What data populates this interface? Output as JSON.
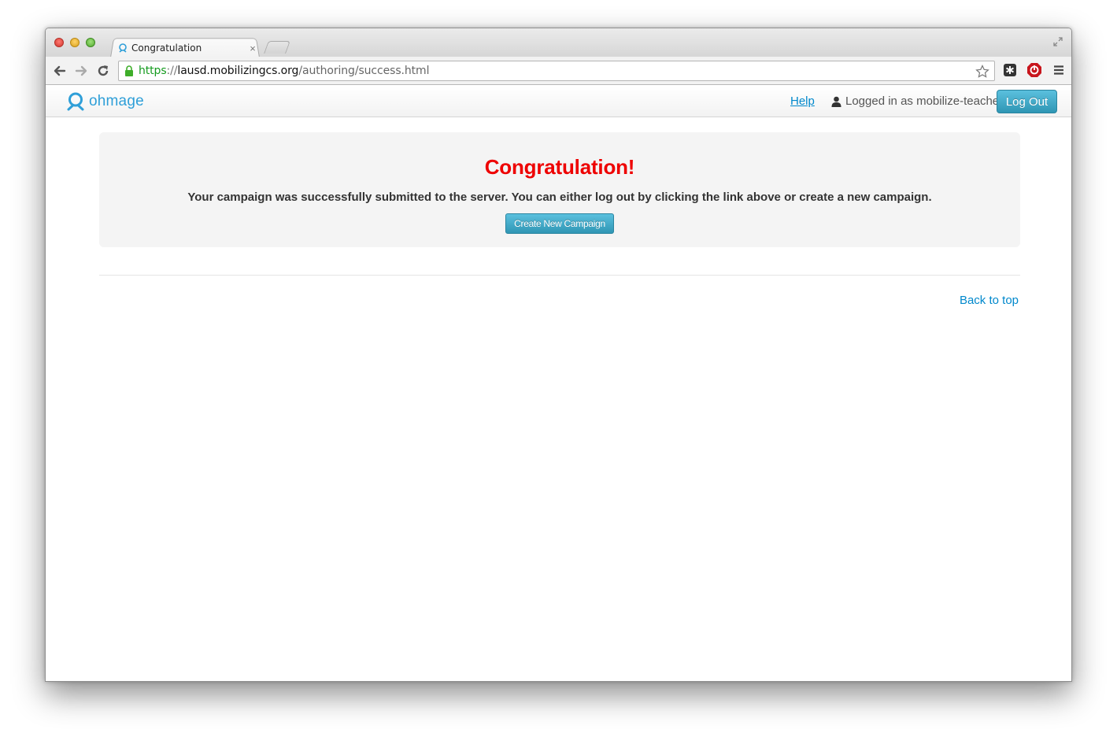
{
  "browser": {
    "tab_title": "Congratulation",
    "tab_close": "×",
    "url": {
      "scheme": "https",
      "separator": "://",
      "host": "lausd.mobilizingcs.org",
      "path": "/authoring/success.html"
    },
    "icons": [
      "back-icon",
      "forward-icon",
      "reload-icon",
      "lock-icon",
      "star-icon",
      "extension-icon",
      "stop-extension-icon",
      "menu-icon"
    ]
  },
  "navbar": {
    "brand": "ohmage",
    "help_label": "Help",
    "user_label": "Logged in as mobilize-teacher",
    "logout_label": "Log Out"
  },
  "hero": {
    "title": "Congratulation!",
    "message": "Your campaign was successfully submitted to the server. You can either log out by clicking the link above or create a new campaign.",
    "button_label": "Create New Campaign"
  },
  "footer": {
    "back_to_top": "Back to top"
  },
  "colors": {
    "accent": "#2f96b4",
    "title_red": "#ee0000",
    "link": "#0088cc"
  }
}
